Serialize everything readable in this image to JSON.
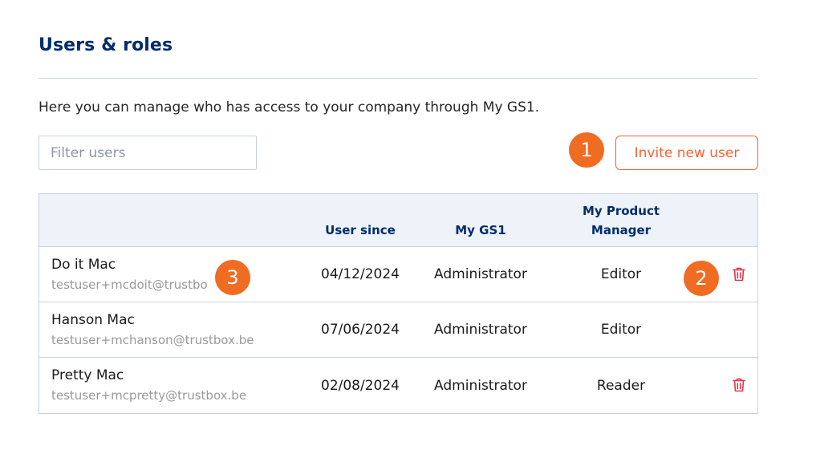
{
  "header": {
    "title": "Users & roles",
    "intro": "Here you can manage who has access to your company through My GS1."
  },
  "filter": {
    "placeholder": "Filter users"
  },
  "invite_button": {
    "label": "Invite new user"
  },
  "table": {
    "columns": {
      "user_since": "User since",
      "my_gs1": "My GS1",
      "product_manager_line1": "My Product",
      "product_manager_line2": "Manager"
    },
    "rows": [
      {
        "name": "Do it Mac",
        "email": "testuser+mcdoit@trustbo",
        "since": "04/12/2024",
        "gs1": "Administrator",
        "pm": "Editor",
        "deletable": true
      },
      {
        "name": "Hanson Mac",
        "email": "testuser+mchanson@trustbox.be",
        "since": "07/06/2024",
        "gs1": "Administrator",
        "pm": "Editor",
        "deletable": false
      },
      {
        "name": "Pretty Mac",
        "email": "testuser+mcpretty@trustbox.be",
        "since": "02/08/2024",
        "gs1": "Administrator",
        "pm": "Reader",
        "deletable": true
      }
    ]
  },
  "callouts": {
    "one": "1",
    "two": "2",
    "three": "3"
  },
  "icons": {
    "delete": "trash-icon"
  },
  "colors": {
    "brand_navy": "#002c6c",
    "accent_orange": "#f26334",
    "callout_orange": "#ef6c22",
    "delete_red": "#e0364a"
  }
}
